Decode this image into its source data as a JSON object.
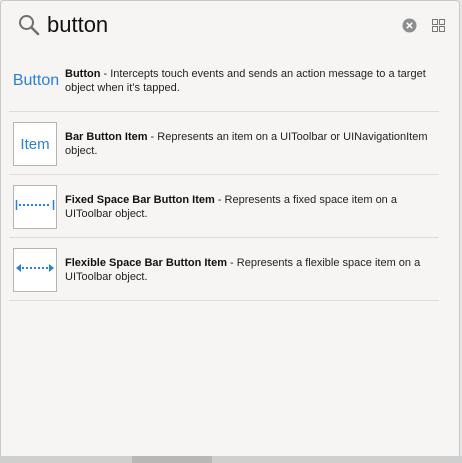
{
  "search": {
    "value": "button"
  },
  "items": [
    {
      "thumb": "Button",
      "title": "Button",
      "desc": "Intercepts touch events and sends an action message to a target object when it’s tapped."
    },
    {
      "thumb": "Item",
      "title": "Bar Button Item",
      "desc": "Represents an item on a UIToolbar or UINavigationItem object."
    },
    {
      "thumb_icon": "fixed-space-icon",
      "title": "Fixed Space Bar Button Item",
      "desc": "Represents a fixed space item on a UIToolbar object."
    },
    {
      "thumb_icon": "flexible-space-icon",
      "title": "Flexible Space Bar Button Item",
      "desc": "Represents a flexible space item on a UIToolbar object."
    }
  ],
  "separator": " - ",
  "colors": {
    "accent": "#2a7fd8",
    "background": "#f6f5f4"
  }
}
